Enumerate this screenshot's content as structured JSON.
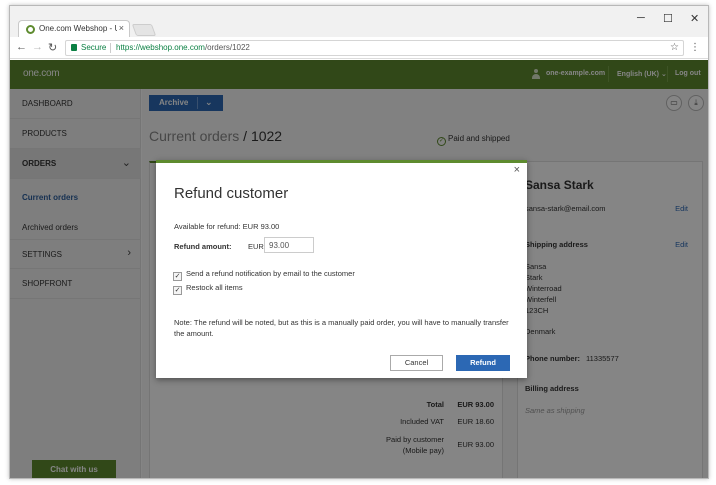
{
  "browser": {
    "tab_title": "One.com Webshop - Up",
    "tab_close": "×",
    "secure_label": "Secure",
    "url_host": "https://webshop.one.com",
    "url_path": "/orders/1022",
    "win_min": "─",
    "win_max": "☐",
    "win_close": "✕"
  },
  "header": {
    "logo": "one.com",
    "account": "one-example.com",
    "language": "English (UK) ⌄",
    "logout": "Log out"
  },
  "sidebar": {
    "items": [
      {
        "label": "DASHBOARD"
      },
      {
        "label": "PRODUCTS"
      },
      {
        "label": "ORDERS"
      },
      {
        "label": "SETTINGS"
      },
      {
        "label": "SHOPFRONT"
      }
    ],
    "sub_current": "Current orders",
    "sub_archived": "Archived orders",
    "chat": "Chat with us"
  },
  "main": {
    "archive_label": "Archive",
    "title_prefix": "Current orders",
    "title_sep": " / ",
    "title_id": "1022",
    "status": "Paid and shipped",
    "totals": {
      "total_label": "Total",
      "total_value": "EUR 93.00",
      "vat_label": "Included VAT",
      "vat_value": "EUR 18.60",
      "paid_label_1": "Paid by customer",
      "paid_label_2": "(Mobile pay)",
      "paid_value": "EUR 93.00"
    }
  },
  "customer": {
    "name": "Sansa Stark",
    "email": "sansa-stark@email.com",
    "edit": "Edit",
    "shipping_head": "Shipping address",
    "address": [
      "Sansa",
      "Stark",
      "Winterroad",
      "Winterfell",
      "123CH",
      "",
      "Denmark"
    ],
    "phone_label": "Phone number:",
    "phone": "11335577",
    "billing_head": "Billing address",
    "billing_note": "Same as shipping"
  },
  "modal": {
    "close": "×",
    "title": "Refund customer",
    "available": "Available for refund: EUR 93.00",
    "amount_label": "Refund amount:",
    "currency": "EUR",
    "amount_value": "93.00",
    "cb_notify": "Send a refund notification by email to the customer",
    "cb_restock": "Restock all items",
    "cb_notify_checked": true,
    "cb_restock_checked": true,
    "note": "Note: The refund will be noted, but as this is a manually paid order, you will have to manually transfer the amount.",
    "cancel": "Cancel",
    "refund": "Refund"
  },
  "colors": {
    "brand_green": "#5e8b2f",
    "primary_blue": "#2c68b4"
  }
}
